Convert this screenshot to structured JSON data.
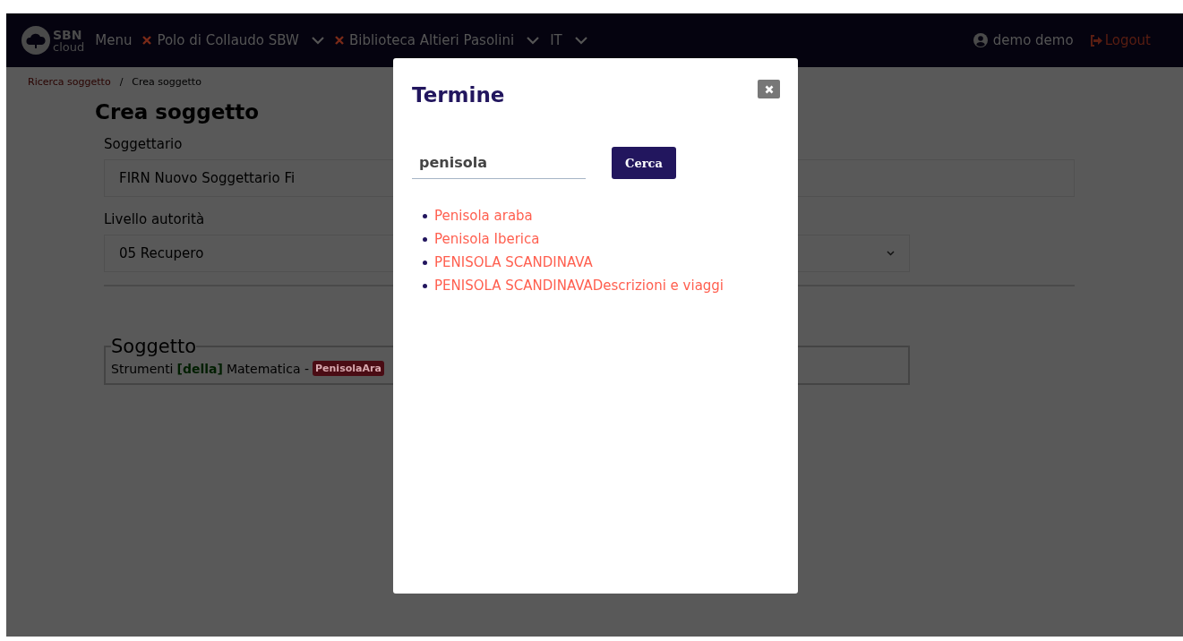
{
  "navbar": {
    "logo_text": "SBN",
    "logo_subtext": "cloud",
    "menu": "Menu",
    "selectors": [
      {
        "label": "Polo di Collaudo SBW",
        "removable": true
      },
      {
        "label": "Biblioteca Altieri Pasolini",
        "removable": true
      },
      {
        "label": "IT",
        "removable": false
      }
    ],
    "user": "demo demo",
    "logout": "Logout"
  },
  "breadcrumb": [
    {
      "label": "Ricerca soggetto",
      "link": true
    },
    {
      "label": "Crea soggetto",
      "link": false
    }
  ],
  "breadcrumb_separator": "/",
  "page_title": "Crea soggetto",
  "fields": [
    {
      "kind": "text",
      "label": "Soggettario",
      "value": "FIRN Nuovo Soggettario Fi"
    },
    {
      "kind": "select",
      "label": "Livello autorità",
      "value": "05 Recupero"
    }
  ],
  "soggetto": {
    "legend": "Soggetto",
    "parts": [
      {
        "kind": "word",
        "text": "Strumenti"
      },
      {
        "kind": "bracket",
        "text": "[della]"
      },
      {
        "kind": "word",
        "text": "Matematica -"
      },
      {
        "kind": "tag",
        "text": "PenisolaAra"
      }
    ]
  },
  "modal": {
    "title": "Termine",
    "search_value": "penisola",
    "search_button": "Cerca",
    "results": [
      "Penisola araba",
      "Penisola Iberica",
      "PENISOLA SCANDINAVA",
      "PENISOLA SCANDINAVADescrizioni e viaggi"
    ]
  }
}
